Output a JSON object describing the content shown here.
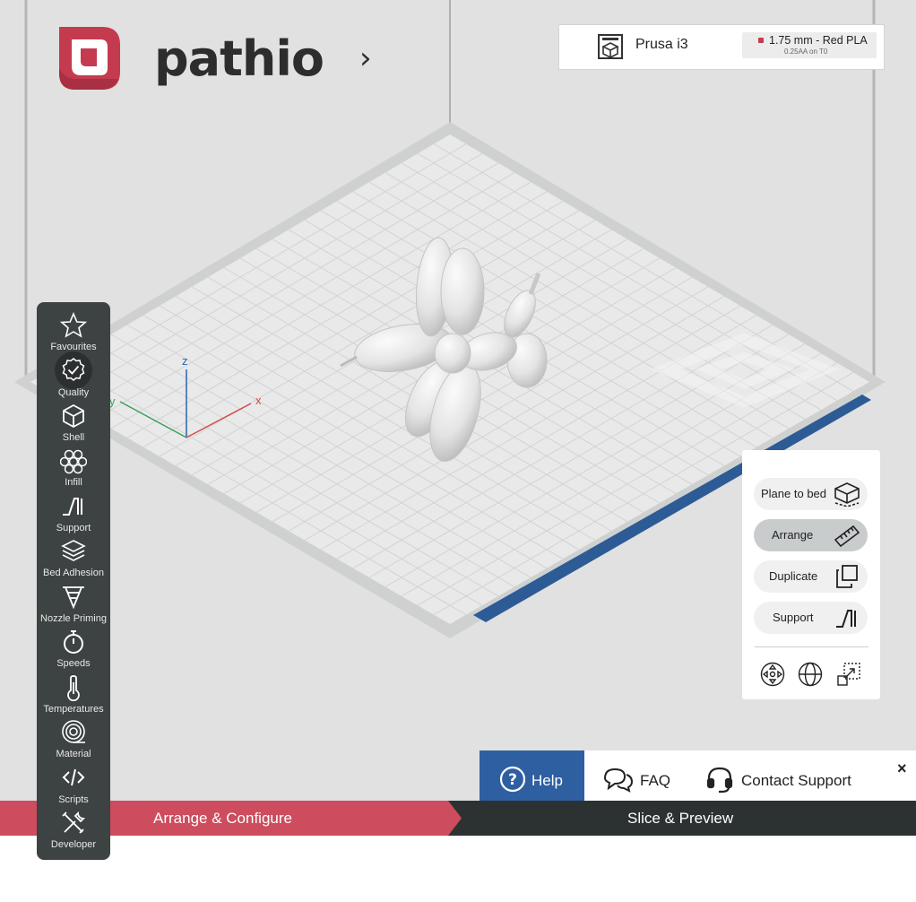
{
  "app": {
    "brand": "pathio",
    "chevron": "›"
  },
  "printer": {
    "name": "Prusa i3",
    "material": "1.75 mm - Red PLA",
    "nozzle": "0.25AA on T0",
    "material_color": "#c43b4f"
  },
  "sidebar": {
    "items": [
      {
        "label": "Favourites",
        "icon": "star-icon"
      },
      {
        "label": "Quality",
        "icon": "quality-check-icon",
        "active": true
      },
      {
        "label": "Shell",
        "icon": "cube-icon"
      },
      {
        "label": "Infill",
        "icon": "honeycomb-icon"
      },
      {
        "label": "Support",
        "icon": "support-icon"
      },
      {
        "label": "Bed Adhesion",
        "icon": "layers-icon"
      },
      {
        "label": "Nozzle Priming",
        "icon": "nozzle-icon"
      },
      {
        "label": "Speeds",
        "icon": "stopwatch-icon"
      },
      {
        "label": "Temperatures",
        "icon": "thermometer-icon"
      },
      {
        "label": "Material",
        "icon": "filament-spool-icon"
      },
      {
        "label": "Scripts",
        "icon": "code-icon"
      },
      {
        "label": "Developer",
        "icon": "tools-icon"
      }
    ]
  },
  "tools": {
    "buttons": [
      {
        "label": "Plane to bed",
        "icon": "plane-to-bed-icon"
      },
      {
        "label": "Arrange",
        "icon": "ruler-icon",
        "active": true
      },
      {
        "label": "Duplicate",
        "icon": "duplicate-icon"
      },
      {
        "label": "Support",
        "icon": "support-icon"
      }
    ],
    "view_icons": [
      "move-icon",
      "rotate-icon",
      "scale-icon"
    ]
  },
  "axes": {
    "x": "x",
    "y": "y",
    "z": "z"
  },
  "help": {
    "help_label": "Help",
    "faq_label": "FAQ",
    "contact_label": "Contact Support",
    "close": "×"
  },
  "steps": {
    "step1": "Arrange & Configure",
    "step2": "Slice & Preview"
  },
  "colors": {
    "accent_red": "#cd4c5e",
    "dark": "#2c3232",
    "help_blue": "#2e5fa1",
    "bed_edge": "#2d5b95"
  }
}
